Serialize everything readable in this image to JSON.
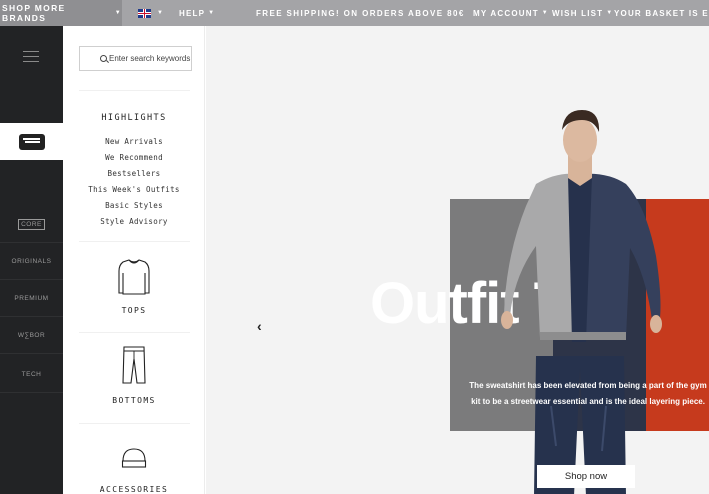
{
  "topbar": {
    "brands_label": "SHOP MORE BRANDS",
    "help_label": "HELP",
    "shipping_text": "FREE SHIPPING! ON ORDERS ABOVE 80€",
    "account_label": "MY ACCOUNT",
    "wishlist_label": "WISH LIST",
    "basket_label": "YOUR BASKET IS EM"
  },
  "rail": {
    "brands": [
      {
        "label": "CORE",
        "icon": "core-brand-logo"
      },
      {
        "label": "ORIGINALS",
        "icon": "originals-brand-logo"
      },
      {
        "label": "PREMIUM",
        "icon": "premium-brand-logo"
      },
      {
        "label": "W∑BOR",
        "icon": "webor-brand-logo"
      },
      {
        "label": "TECH",
        "icon": "tech-brand-logo"
      }
    ]
  },
  "panel": {
    "search_placeholder": "Enter search keywords",
    "highlights_title": "HIGHLIGHTS",
    "highlights": [
      "New Arrivals",
      "We Recommend",
      "Bestsellers",
      "This Week's Outfits",
      "Basic Styles",
      "Style Advisory"
    ],
    "categories": [
      {
        "label": "TOPS",
        "icon": "sweater-icon"
      },
      {
        "label": "BOTTOMS",
        "icon": "trousers-icon"
      },
      {
        "label": "ACCESSORIES",
        "icon": "beanie-icon"
      }
    ]
  },
  "hero": {
    "title": "Outfit Th",
    "caption": "The sweatshirt has been elevated from being a part of the gym kit to be a streetwear essential and is the ideal layering piece.",
    "cta_label": "Shop now",
    "colors": {
      "gray": "#7b7b7c",
      "navy": "#2d3448",
      "red": "#c63a1d"
    }
  }
}
